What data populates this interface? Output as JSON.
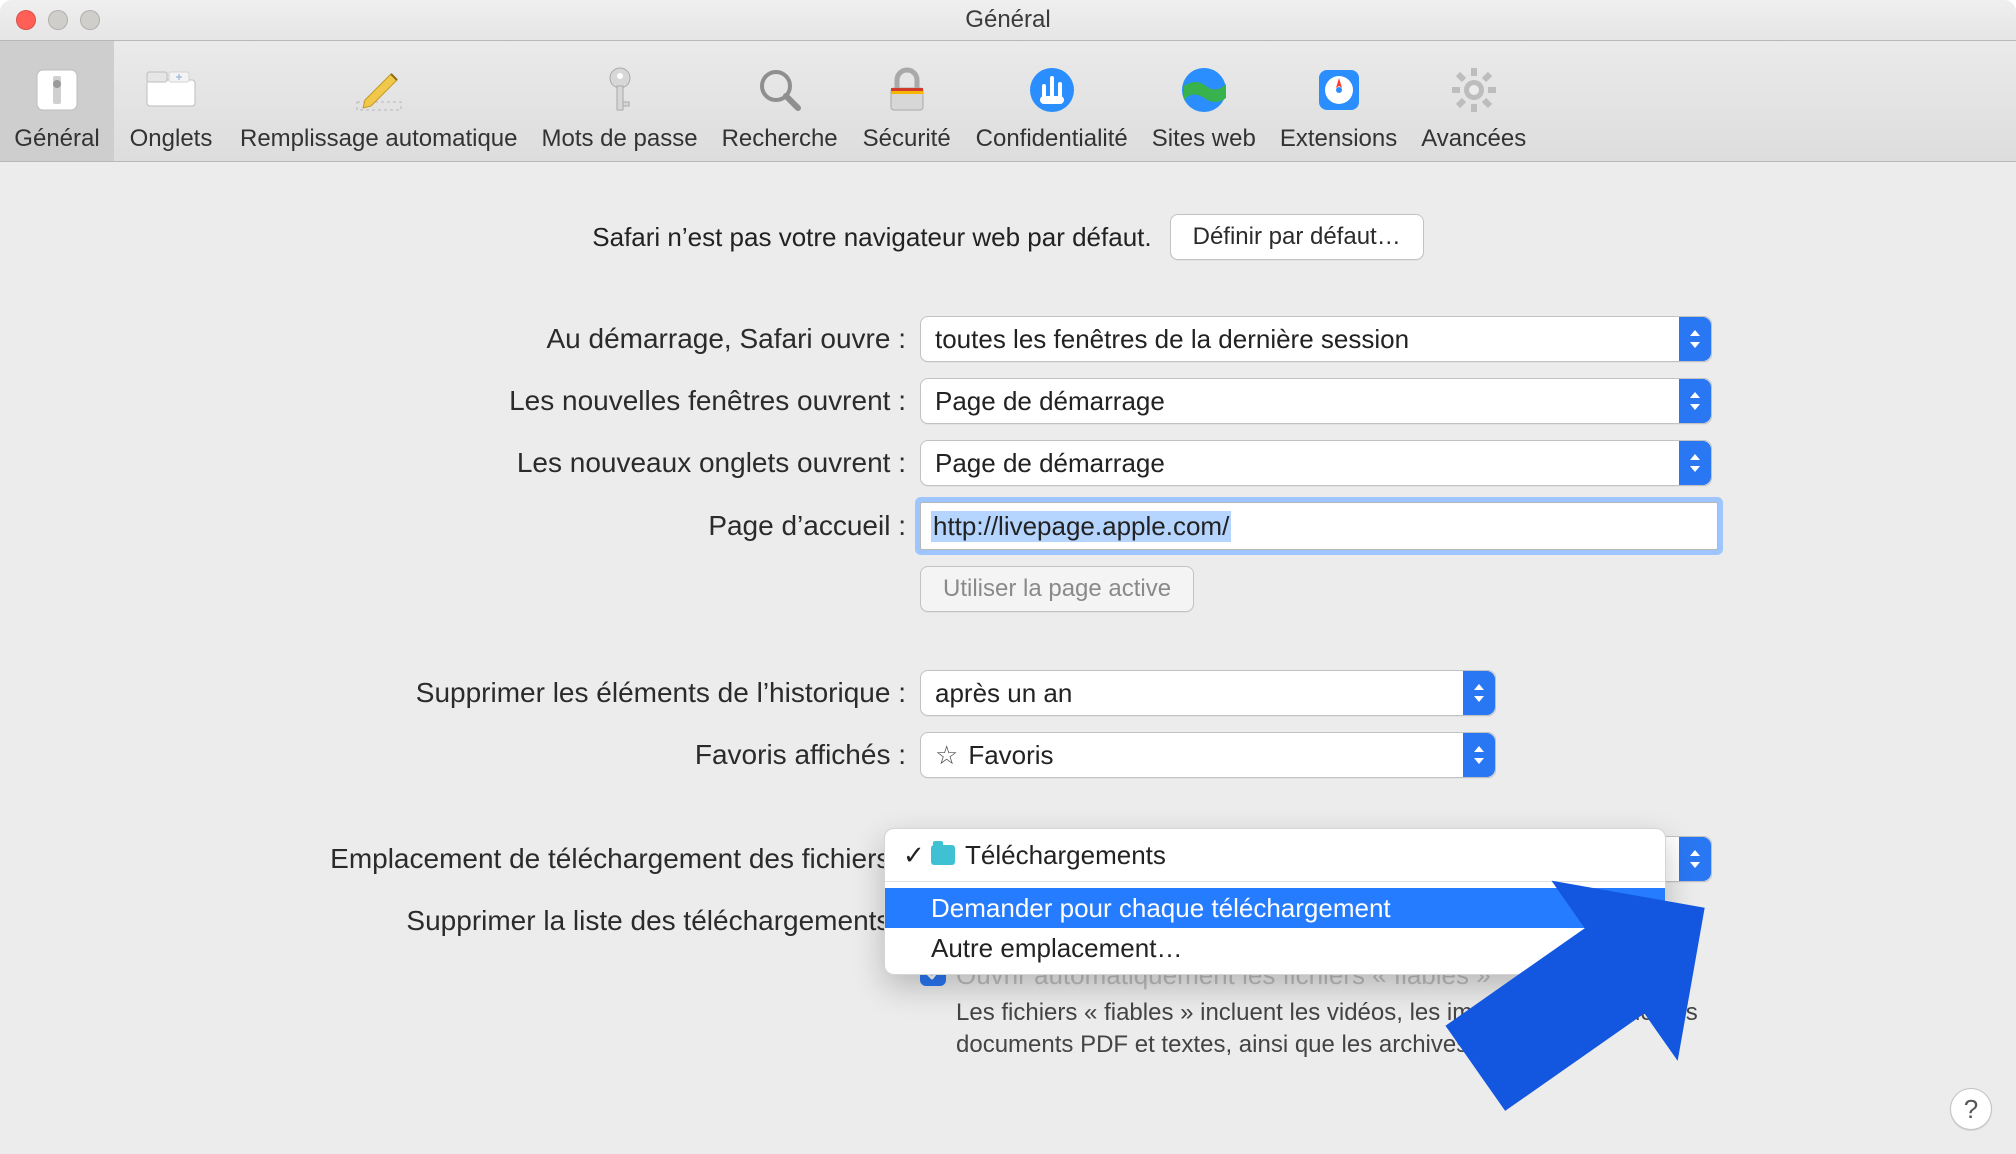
{
  "window": {
    "title": "Général"
  },
  "toolbar": {
    "items": [
      {
        "label": "Général"
      },
      {
        "label": "Onglets"
      },
      {
        "label": "Remplissage automatique"
      },
      {
        "label": "Mots de passe"
      },
      {
        "label": "Recherche"
      },
      {
        "label": "Sécurité"
      },
      {
        "label": "Confidentialité"
      },
      {
        "label": "Sites web"
      },
      {
        "label": "Extensions"
      },
      {
        "label": "Avancées"
      }
    ]
  },
  "default_browser": {
    "message": "Safari n’est pas votre navigateur web par défaut.",
    "button": "Définir par défaut…"
  },
  "form": {
    "safari_opens_label": "Au démarrage, Safari ouvre :",
    "safari_opens_value": "toutes les fenêtres de la dernière session",
    "new_windows_label": "Les nouvelles fenêtres ouvrent :",
    "new_windows_value": "Page de démarrage",
    "new_tabs_label": "Les nouveaux onglets ouvrent :",
    "new_tabs_value": "Page de démarrage",
    "homepage_label": "Page d’accueil :",
    "homepage_value": "http://livepage.apple.com/",
    "set_current_page": "Utiliser la page active",
    "history_label": "Supprimer les éléments de l’historique :",
    "history_value": "après un an",
    "favorites_label": "Favoris affichés :",
    "favorites_value": "Favoris",
    "download_location_label": "Emplacement de téléchargement des fichiers :",
    "download_remove_label": "Supprimer la liste des téléchargements :",
    "open_safe_text_obscured": "Ouvrir automatiquement les fichiers « fiables »",
    "open_safe_note": "Les fichiers « fiables » incluent les vidéos, les images, la musique, les documents PDF et textes, ainsi que les archives."
  },
  "download_menu": {
    "item_downloads": "Téléchargements",
    "item_ask_each": "Demander pour chaque téléchargement",
    "item_other": "Autre emplacement…"
  },
  "help": "?"
}
